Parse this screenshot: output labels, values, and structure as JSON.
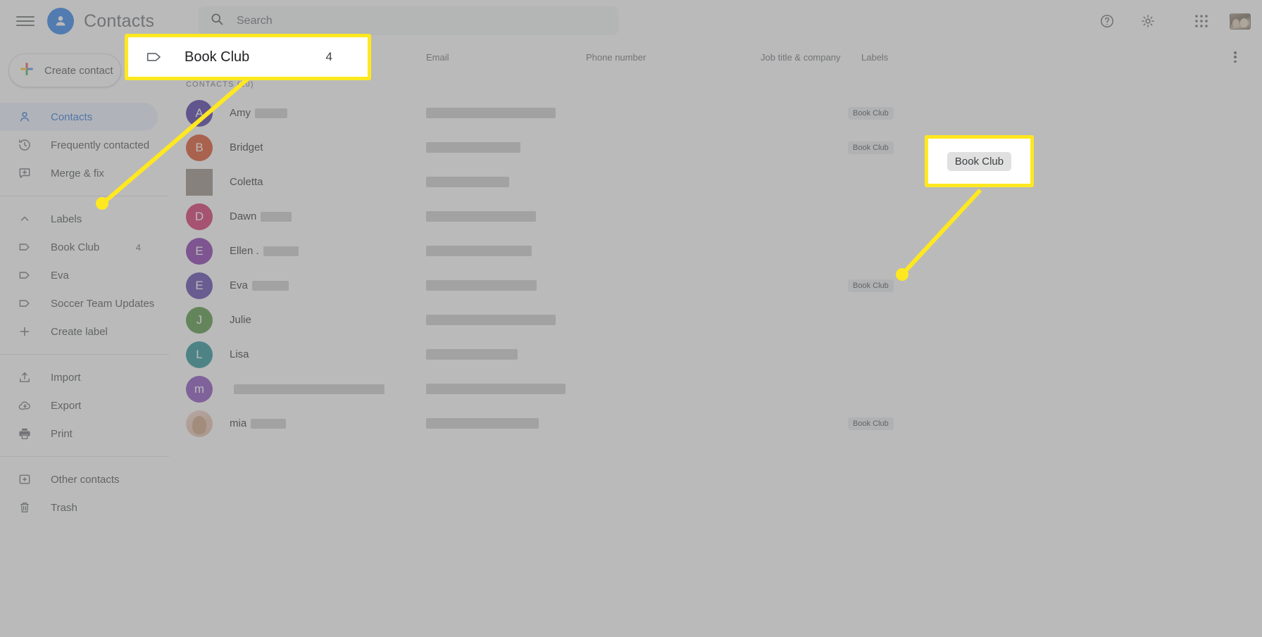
{
  "app": {
    "title": "Contacts",
    "brand_color": "#1a73e8",
    "highlight_color": "#ffe820"
  },
  "topbar": {
    "menu_icon": "hamburger-menu-icon",
    "logo_icon": "contacts-person-icon",
    "search": {
      "icon": "search-icon",
      "placeholder": "Search",
      "value": ""
    },
    "help_icon": "help-circle-icon",
    "settings_icon": "gear-icon",
    "apps_icon": "apps-grid-icon",
    "account_avatar": "account-avatar"
  },
  "sidebar": {
    "create_button": {
      "label": "Create contact",
      "icon": "plus-multicolor-icon"
    },
    "items": [
      {
        "label": "Contacts",
        "icon": "person-outline-icon",
        "active": true,
        "count": ""
      },
      {
        "label": "Frequently contacted",
        "icon": "history-clock-icon",
        "active": false,
        "count": ""
      },
      {
        "label": "Merge & fix",
        "icon": "merge-fix-icon",
        "active": false,
        "count": ""
      }
    ],
    "labels_section": {
      "label": "Labels",
      "icon": "chevron-up-icon",
      "items": [
        {
          "label": "Book Club",
          "icon": "label-tag-icon",
          "count": "4"
        },
        {
          "label": "Eva",
          "icon": "label-tag-icon",
          "count": ""
        },
        {
          "label": "Soccer Team Updates",
          "icon": "label-tag-icon",
          "count": ""
        },
        {
          "label": "Create label",
          "icon": "plus-icon",
          "count": ""
        }
      ]
    },
    "tools": [
      {
        "label": "Import",
        "icon": "import-upload-icon"
      },
      {
        "label": "Export",
        "icon": "export-cloud-download-icon"
      },
      {
        "label": "Print",
        "icon": "printer-icon"
      }
    ],
    "bottom": [
      {
        "label": "Other contacts",
        "icon": "other-contacts-icon"
      },
      {
        "label": "Trash",
        "icon": "trash-icon"
      }
    ]
  },
  "main": {
    "columns": [
      {
        "key": "name",
        "label": ""
      },
      {
        "key": "email",
        "label": "Email"
      },
      {
        "key": "phone",
        "label": "Phone number"
      },
      {
        "key": "job",
        "label": "Job title & company"
      },
      {
        "key": "labels",
        "label": "Labels"
      }
    ],
    "more_options_icon": "more-vertical-icon",
    "contacts_header": "CONTACTS (10)",
    "rows": [
      {
        "name": "Amy",
        "initial": "A",
        "avatar_color": "#3b219b",
        "avatar_type": "initial",
        "redacted_name_w": 46,
        "email_redacted_w": 184,
        "label": "Book Club"
      },
      {
        "name": "Bridget",
        "initial": "B",
        "avatar_color": "#d93c10",
        "avatar_type": "initial",
        "redacted_name_w": 0,
        "email_redacted_w": 134,
        "label": "Book Club"
      },
      {
        "name": "Coletta",
        "initial": "",
        "avatar_color": "#8d8179",
        "avatar_type": "blank",
        "redacted_name_w": 0,
        "email_redacted_w": 118,
        "label": ""
      },
      {
        "name": "Dawn",
        "initial": "D",
        "avatar_color": "#d01c5b",
        "avatar_type": "initial",
        "redacted_name_w": 44,
        "email_redacted_w": 156,
        "label": ""
      },
      {
        "name": "Ellen .",
        "initial": "E",
        "avatar_color": "#7b1fa2",
        "avatar_type": "initial",
        "redacted_name_w": 50,
        "email_redacted_w": 150,
        "label": ""
      },
      {
        "name": "Eva",
        "initial": "E",
        "avatar_color": "#4a2fa3",
        "avatar_type": "initial",
        "redacted_name_w": 52,
        "email_redacted_w": 157,
        "label": "Book Club"
      },
      {
        "name": "Julie",
        "initial": "J",
        "avatar_color": "#41892e",
        "avatar_type": "initial",
        "redacted_name_w": 0,
        "email_redacted_w": 184,
        "label": ""
      },
      {
        "name": "Lisa",
        "initial": "L",
        "avatar_color": "#11868d",
        "avatar_type": "initial",
        "redacted_name_w": 0,
        "email_redacted_w": 130,
        "label": ""
      },
      {
        "name": "",
        "initial": "m",
        "avatar_color": "#7e3dba",
        "avatar_type": "initial",
        "redacted_name_w": 214,
        "email_redacted_w": 198,
        "label": ""
      },
      {
        "name": "mia",
        "initial": "",
        "avatar_color": "#e8c0ad",
        "avatar_type": "photo",
        "redacted_name_w": 50,
        "email_redacted_w": 160,
        "label": "Book Club"
      }
    ]
  },
  "callouts": {
    "label_callout": {
      "icon": "label-tag-icon",
      "name": "Book Club",
      "count": "4"
    },
    "chip_callout": {
      "text": "Book Club"
    }
  }
}
